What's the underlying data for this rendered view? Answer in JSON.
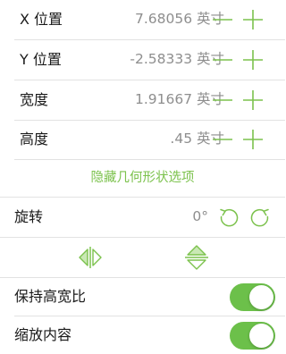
{
  "colors": {
    "accent": "#7cc24d",
    "toggle_on": "#6cc04a",
    "value_text": "#8e8e8e",
    "divider": "#e2e2e2"
  },
  "geometry": {
    "rows": [
      {
        "label": "X 位置",
        "value": "7.68056 英寸"
      },
      {
        "label": "Y 位置",
        "value": "-2.58333 英寸"
      },
      {
        "label": "宽度",
        "value": "1.91667 英寸"
      },
      {
        "label": "高度",
        "value": ".45 英寸"
      }
    ],
    "hide_options_label": "隐藏几何形状选项"
  },
  "rotation": {
    "label": "旋转",
    "value": "0°",
    "rotate_left_icon": "rotate-counterclockwise-icon",
    "rotate_right_icon": "rotate-clockwise-icon"
  },
  "flip": {
    "horizontal_icon": "flip-horizontal-icon",
    "vertical_icon": "flip-vertical-icon"
  },
  "toggles": [
    {
      "label": "保持高宽比",
      "on": true
    },
    {
      "label": "缩放内容",
      "on": true
    }
  ]
}
